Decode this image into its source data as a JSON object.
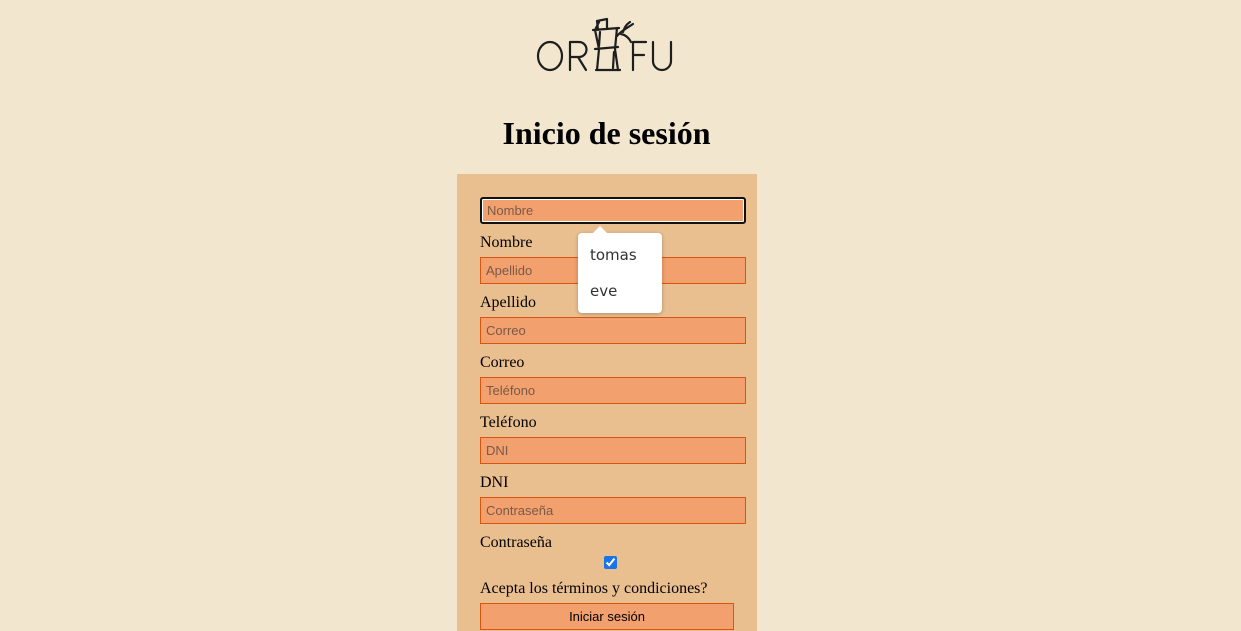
{
  "header": {
    "logo_text": "ORTFU"
  },
  "page_title": "Inicio de sesión",
  "form": {
    "fields": [
      {
        "placeholder": "Nombre",
        "label": "Nombre"
      },
      {
        "placeholder": "Apellido",
        "label": "Apellido"
      },
      {
        "placeholder": "Correo",
        "label": "Correo"
      },
      {
        "placeholder": "Teléfono",
        "label": "Teléfono"
      },
      {
        "placeholder": "DNI",
        "label": "DNI"
      },
      {
        "placeholder": "Contraseña",
        "label": "Contraseña"
      }
    ],
    "terms_checked": true,
    "terms_label": "Acepta los términos y condiciones?",
    "submit_label": "Iniciar sesión"
  },
  "autocomplete": {
    "items": [
      "tomas",
      "eve"
    ]
  },
  "colors": {
    "page_background": "#f2e6cf",
    "card_background": "#eabf90",
    "input_background": "#f2a06e",
    "input_border": "#d9550f"
  }
}
